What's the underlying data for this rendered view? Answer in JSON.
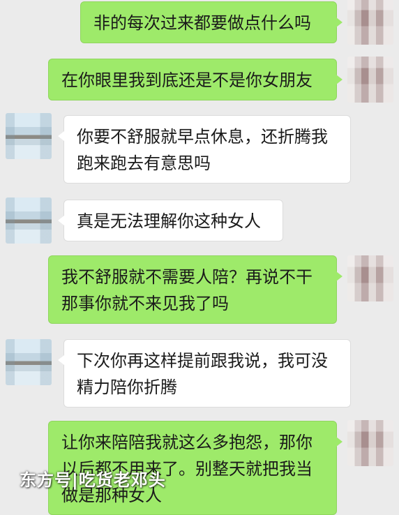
{
  "messages": [
    {
      "side": "sent",
      "lines": [
        "非的每次过来都要做点什么吗"
      ]
    },
    {
      "side": "sent",
      "lines": [
        "在你眼里我到底还是不是你女朋友"
      ]
    },
    {
      "side": "recv",
      "lines": [
        "你要不舒服就早点休息，还折腾我",
        "跑来跑去有意思吗"
      ]
    },
    {
      "side": "recv",
      "lines": [
        "真是无法理解你这种女人"
      ]
    },
    {
      "side": "sent",
      "lines": [
        "我不舒服就不需要人陪？再说不干",
        "那事你就不来见我了吗"
      ]
    },
    {
      "side": "recv",
      "lines": [
        "下次你再这样提前跟我说，我可没",
        "精力陪你折腾"
      ]
    },
    {
      "side": "sent",
      "lines": [
        "让你来陪陪我就这么多抱怨，那你",
        "以后都不用来了。别整天就把我当",
        "做是那种女人"
      ]
    }
  ],
  "watermark": "东方号|吃货老邓头",
  "colors": {
    "sent_bubble": "#9eea6a",
    "recv_bubble": "#ffffff",
    "background": "#ebebeb"
  }
}
